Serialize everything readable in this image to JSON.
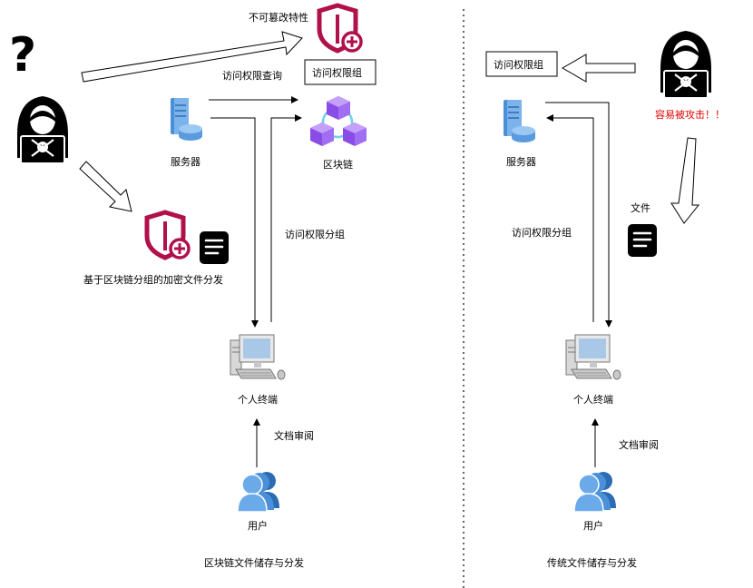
{
  "left": {
    "tamper_proof_label": "不可篡改特性",
    "access_query_label": "访问权限查询",
    "access_group_box": "访问权限组",
    "server_label": "服务器",
    "blockchain_label": "区块链",
    "access_group_edge": "访问权限分组",
    "encrypted_dist_label": "基于区块链分组的加密文件分发",
    "terminal_label": "个人终端",
    "doc_review_label": "文档审阅",
    "user_label": "用户",
    "caption": "区块链文件储存与分发"
  },
  "right": {
    "access_group_box": "访问权限组",
    "attack_label": "容易被攻击！！",
    "server_label": "服务器",
    "file_label": "文件",
    "access_group_edge": "访问权限分组",
    "terminal_label": "个人终端",
    "doc_review_label": "文档审阅",
    "user_label": "用户",
    "caption": "传统文件储存与分发"
  },
  "icons": {
    "question": "question-mark-icon",
    "hacker": "hacker-icon",
    "shield": "shield-plus-icon",
    "server": "server-icon",
    "blockchain": "blockchain-cubes-icon",
    "document": "document-icon",
    "computer": "desktop-computer-icon",
    "users": "users-icon"
  },
  "colors": {
    "shield": "#b0114a",
    "cube": "#9a5cf0",
    "server": "#4a8fd8",
    "attack_text": "#e00000"
  }
}
